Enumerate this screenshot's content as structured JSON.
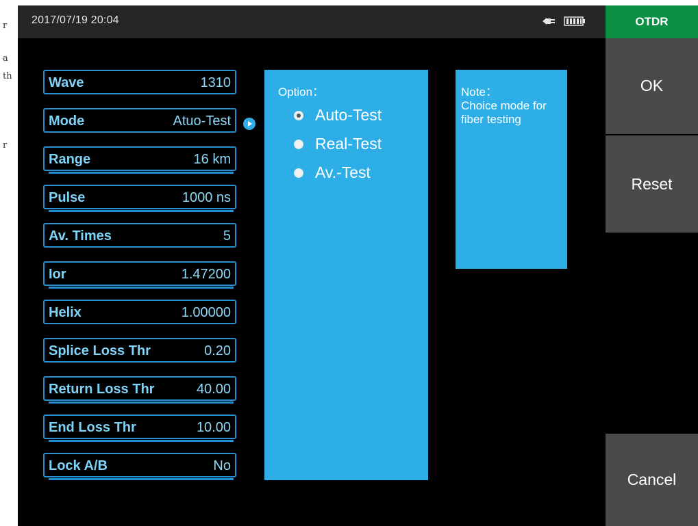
{
  "margin_text": [
    "r",
    "a",
    "th",
    "r"
  ],
  "status_bar": {
    "datetime": "2017/07/19 20:04",
    "power_icon": "plug-icon",
    "battery_icon": "battery-full-icon"
  },
  "mode_tab": {
    "label": "OTDR"
  },
  "side_buttons": {
    "ok": "OK",
    "reset": "Reset",
    "cancel": "Cancel"
  },
  "params": [
    {
      "label": "Wave",
      "value": "1310"
    },
    {
      "label": "Mode",
      "value": "Atuo-Test"
    },
    {
      "label": "Range",
      "value": "16 km"
    },
    {
      "label": "Pulse",
      "value": "1000 ns"
    },
    {
      "label": "Av. Times",
      "value": "5"
    },
    {
      "label": "Ior",
      "value": "1.47200"
    },
    {
      "label": "Helix",
      "value": "1.00000"
    },
    {
      "label": "Splice Loss Thr",
      "value": "0.20"
    },
    {
      "label": "Return Loss Thr",
      "value": "40.00"
    },
    {
      "label": "End Loss Thr",
      "value": "10.00"
    },
    {
      "label": "Lock A/B",
      "value": "No"
    }
  ],
  "option_panel": {
    "title": "Option：",
    "options": [
      {
        "label": "Auto-Test",
        "selected": true
      },
      {
        "label": "Real-Test",
        "selected": false
      },
      {
        "label": "Av.-Test",
        "selected": false
      }
    ]
  },
  "note_panel": {
    "title": "Note：",
    "text": "Choice mode for fiber testing"
  },
  "colors": {
    "accent_green": "#0a9146",
    "panel_blue": "#2daee6",
    "param_border": "#2b8fd6",
    "side_button": "#4a4a4a"
  }
}
